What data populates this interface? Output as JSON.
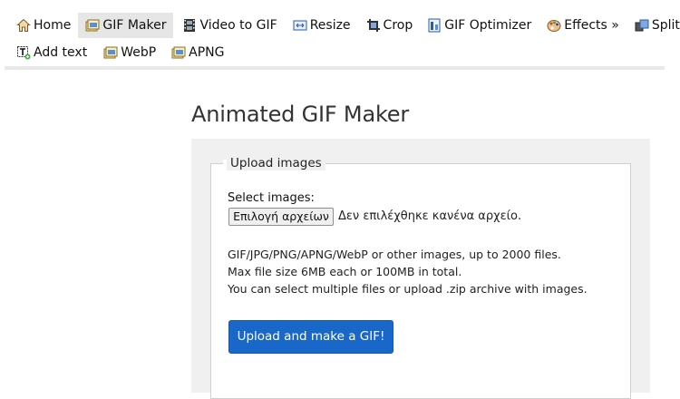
{
  "nav": {
    "row1": [
      {
        "label": "Home",
        "icon": "home-icon"
      },
      {
        "label": "GIF Maker",
        "icon": "gif-maker-icon",
        "active": true
      },
      {
        "label": "Video to GIF",
        "icon": "film-icon"
      },
      {
        "label": "Resize",
        "icon": "resize-icon"
      },
      {
        "label": "Crop",
        "icon": "crop-icon"
      },
      {
        "label": "GIF Optimizer",
        "icon": "optimizer-icon"
      },
      {
        "label": "Effects »",
        "icon": "palette-icon"
      },
      {
        "label": "Split",
        "icon": "split-icon"
      }
    ],
    "row2": [
      {
        "label": "Add text",
        "icon": "add-text-icon"
      },
      {
        "label": "WebP",
        "icon": "webp-icon"
      },
      {
        "label": "APNG",
        "icon": "apng-icon"
      }
    ]
  },
  "page": {
    "title": "Animated GIF Maker"
  },
  "upload": {
    "legend": "Upload images",
    "select_label": "Select images:",
    "file_button": "Επιλογή αρχείων",
    "file_status": "Δεν επιλέχθηκε κανένα αρχείο.",
    "info_lines": [
      "GIF/JPG/PNG/APNG/WebP or other images, up to 2000 files.",
      "Max file size 6MB each or 100MB in total.",
      "You can select multiple files or upload .zip archive with images."
    ],
    "submit_label": "Upload and make a GIF!"
  },
  "colors": {
    "accent": "#1967c8",
    "panel_bg": "#f0f0f0",
    "active_tab_bg": "#e6e6e6"
  }
}
